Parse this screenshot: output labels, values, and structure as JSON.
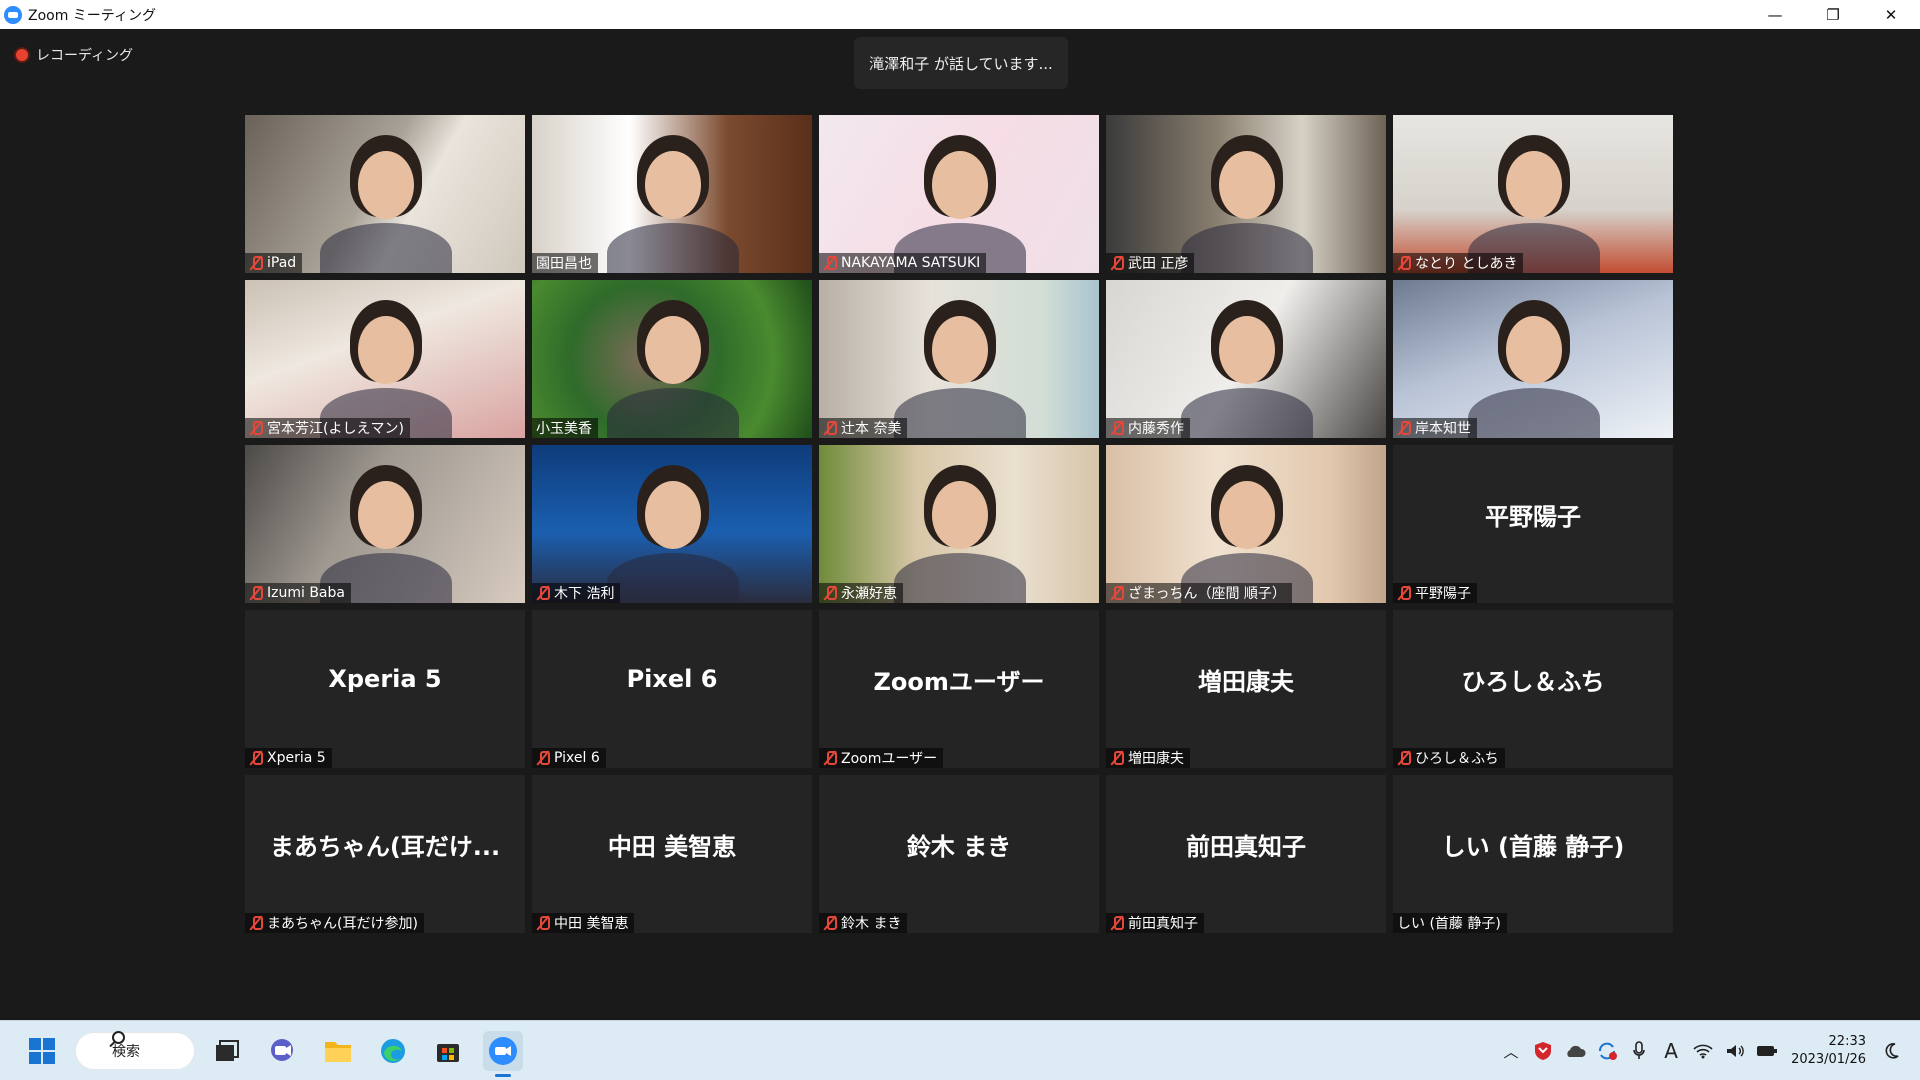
{
  "window": {
    "title": "Zoom ミーティング",
    "controls": {
      "minimize": "—",
      "restore": "❐",
      "close": "✕"
    }
  },
  "meeting": {
    "recording_label": "レコーディング",
    "speaking_banner": "滝澤和子 が話しています...",
    "participants": [
      {
        "label": "iPad",
        "video": "v1",
        "muted": true
      },
      {
        "label": "園田昌也",
        "video": "v2",
        "muted": false
      },
      {
        "label": "NAKAYAMA SATSUKI",
        "video": "v3",
        "muted": true
      },
      {
        "label": "武田 正彦",
        "video": "v4",
        "muted": true
      },
      {
        "label": "なとり としあき",
        "video": "v5",
        "muted": true
      },
      {
        "label": "宮本芳江(よしえマン)",
        "video": "v6",
        "muted": true
      },
      {
        "label": "小玉美香",
        "video": "v7",
        "muted": false
      },
      {
        "label": "辻本 奈美",
        "video": "v8",
        "muted": true
      },
      {
        "label": "内藤秀作",
        "video": "v9",
        "muted": true
      },
      {
        "label": "岸本知世",
        "video": "v10",
        "muted": true
      },
      {
        "label": "Izumi Baba",
        "video": "v11",
        "muted": true
      },
      {
        "label": "木下 浩利",
        "video": "v12",
        "muted": true
      },
      {
        "label": "永瀬好恵",
        "video": "v13",
        "muted": true
      },
      {
        "label": "ざまっちん（座間 順子）",
        "video": "v14",
        "muted": true
      },
      {
        "label": "平野陽子",
        "center": "平野陽子",
        "muted": true
      },
      {
        "label": "Xperia 5",
        "center": "Xperia 5",
        "muted": true
      },
      {
        "label": "Pixel 6",
        "center": "Pixel 6",
        "muted": true
      },
      {
        "label": "Zoomユーザー",
        "center": "Zoomユーザー",
        "muted": true
      },
      {
        "label": "増田康夫",
        "center": "増田康夫",
        "muted": true
      },
      {
        "label": "ひろし＆ふち",
        "center": "ひろし＆ふち",
        "muted": true
      },
      {
        "label": "まあちゃん(耳だけ参加)",
        "center": "まあちゃん(耳だけ...",
        "muted": true
      },
      {
        "label": "中田 美智恵",
        "center": "中田 美智恵",
        "muted": true
      },
      {
        "label": "鈴木 まき",
        "center": "鈴木 まき",
        "muted": true
      },
      {
        "label": "前田真知子",
        "center": "前田真知子",
        "muted": true
      },
      {
        "label": "しい (首藤 静子)",
        "center": "しい (首藤 静子)",
        "muted": false
      }
    ]
  },
  "taskbar": {
    "search_label": "検索",
    "apps": [
      "start-icon",
      "task-view-icon",
      "chat-icon",
      "file-explorer-icon",
      "edge-icon",
      "store-icon",
      "zoom-icon"
    ],
    "clock_time": "22:33",
    "clock_date": "2023/01/26",
    "colors": {
      "accent": "#1a74d2",
      "zoom": "#2d8cff",
      "muted_mic": "#e5483a"
    }
  }
}
